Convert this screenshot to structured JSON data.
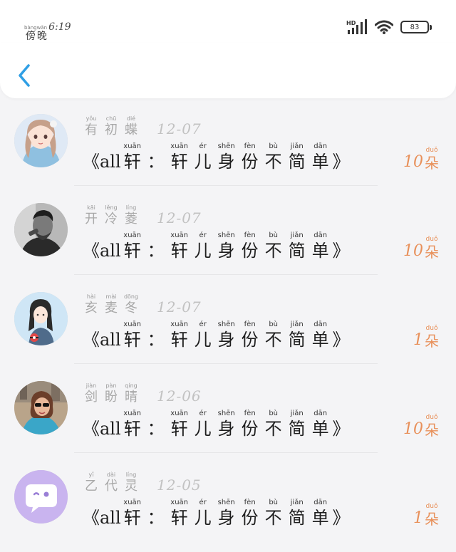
{
  "status_bar": {
    "time_pinyin": [
      "bàng",
      "wǎn"
    ],
    "time_hanzi": [
      "傍",
      "晚"
    ],
    "time_digits": "6:19",
    "network": "HD",
    "battery": "83"
  },
  "nav": {
    "back_icon": "chevron-left-icon",
    "accent": "#2f9fe5"
  },
  "items": [
    {
      "name": [
        {
          "py": "yǒu",
          "hz": "有"
        },
        {
          "py": "chū",
          "hz": "初"
        },
        {
          "py": "dié",
          "hz": "蝶"
        }
      ],
      "date": "12-07",
      "title_prefix": "《all",
      "title_chars": [
        {
          "py": "xuān",
          "hz": "轩"
        },
        {
          "py": "",
          "hz": "："
        },
        {
          "py": "xuān",
          "hz": "轩"
        },
        {
          "py": "ér",
          "hz": "儿"
        },
        {
          "py": "shēn",
          "hz": "身"
        },
        {
          "py": "fèn",
          "hz": "份"
        },
        {
          "py": "bù",
          "hz": "不"
        },
        {
          "py": "jiǎn",
          "hz": "简"
        },
        {
          "py": "dān",
          "hz": "单"
        }
      ],
      "title_suffix": "》",
      "flower_count": "10",
      "flower_pinyin": "duǒ",
      "flower_unit": "朵",
      "avatar": "avatar-girl-anime"
    },
    {
      "name": [
        {
          "py": "kāi",
          "hz": "开"
        },
        {
          "py": "lěng",
          "hz": "冷"
        },
        {
          "py": "líng",
          "hz": "菱"
        }
      ],
      "date": "12-07",
      "title_prefix": "《all",
      "title_chars": [
        {
          "py": "xuān",
          "hz": "轩"
        },
        {
          "py": "",
          "hz": "："
        },
        {
          "py": "xuān",
          "hz": "轩"
        },
        {
          "py": "ér",
          "hz": "儿"
        },
        {
          "py": "shēn",
          "hz": "身"
        },
        {
          "py": "fèn",
          "hz": "份"
        },
        {
          "py": "bù",
          "hz": "不"
        },
        {
          "py": "jiǎn",
          "hz": "简"
        },
        {
          "py": "dān",
          "hz": "单"
        }
      ],
      "title_suffix": "》",
      "flower_count": "10",
      "flower_pinyin": "duǒ",
      "flower_unit": "朵",
      "avatar": "avatar-man-bw"
    },
    {
      "name": [
        {
          "py": "hài",
          "hz": "亥"
        },
        {
          "py": "mài",
          "hz": "麦"
        },
        {
          "py": "dōng",
          "hz": "冬"
        }
      ],
      "date": "12-07",
      "title_prefix": "《all",
      "title_chars": [
        {
          "py": "xuān",
          "hz": "轩"
        },
        {
          "py": "",
          "hz": "："
        },
        {
          "py": "xuān",
          "hz": "轩"
        },
        {
          "py": "ér",
          "hz": "儿"
        },
        {
          "py": "shēn",
          "hz": "身"
        },
        {
          "py": "fèn",
          "hz": "份"
        },
        {
          "py": "bù",
          "hz": "不"
        },
        {
          "py": "jiǎn",
          "hz": "简"
        },
        {
          "py": "dān",
          "hz": "单"
        }
      ],
      "title_suffix": "》",
      "flower_count": "1",
      "flower_pinyin": "duǒ",
      "flower_unit": "朵",
      "avatar": "avatar-girl-cartoon"
    },
    {
      "name": [
        {
          "py": "jiàn",
          "hz": "剑"
        },
        {
          "py": "pàn",
          "hz": "盼"
        },
        {
          "py": "qíng",
          "hz": "晴"
        }
      ],
      "date": "12-06",
      "title_prefix": "《all",
      "title_chars": [
        {
          "py": "xuān",
          "hz": "轩"
        },
        {
          "py": "",
          "hz": "："
        },
        {
          "py": "xuān",
          "hz": "轩"
        },
        {
          "py": "ér",
          "hz": "儿"
        },
        {
          "py": "shēn",
          "hz": "身"
        },
        {
          "py": "fèn",
          "hz": "份"
        },
        {
          "py": "bù",
          "hz": "不"
        },
        {
          "py": "jiǎn",
          "hz": "简"
        },
        {
          "py": "dān",
          "hz": "单"
        }
      ],
      "title_suffix": "》",
      "flower_count": "10",
      "flower_pinyin": "duǒ",
      "flower_unit": "朵",
      "avatar": "avatar-woman-photo"
    },
    {
      "name": [
        {
          "py": "yǐ",
          "hz": "乙"
        },
        {
          "py": "dài",
          "hz": "代"
        },
        {
          "py": "líng",
          "hz": "灵"
        }
      ],
      "date": "12-05",
      "title_prefix": "《all",
      "title_chars": [
        {
          "py": "xuān",
          "hz": "轩"
        },
        {
          "py": "",
          "hz": "："
        },
        {
          "py": "xuān",
          "hz": "轩"
        },
        {
          "py": "ér",
          "hz": "儿"
        },
        {
          "py": "shēn",
          "hz": "身"
        },
        {
          "py": "fèn",
          "hz": "份"
        },
        {
          "py": "bù",
          "hz": "不"
        },
        {
          "py": "jiǎn",
          "hz": "简"
        },
        {
          "py": "dān",
          "hz": "单"
        }
      ],
      "title_suffix": "》",
      "flower_count": "1",
      "flower_pinyin": "duǒ",
      "flower_unit": "朵",
      "avatar": "avatar-default-purple"
    }
  ],
  "colors": {
    "flower": "#e8905a",
    "date": "#c2c2c2",
    "name": "#a8a8a8",
    "accent": "#2f9fe5"
  }
}
